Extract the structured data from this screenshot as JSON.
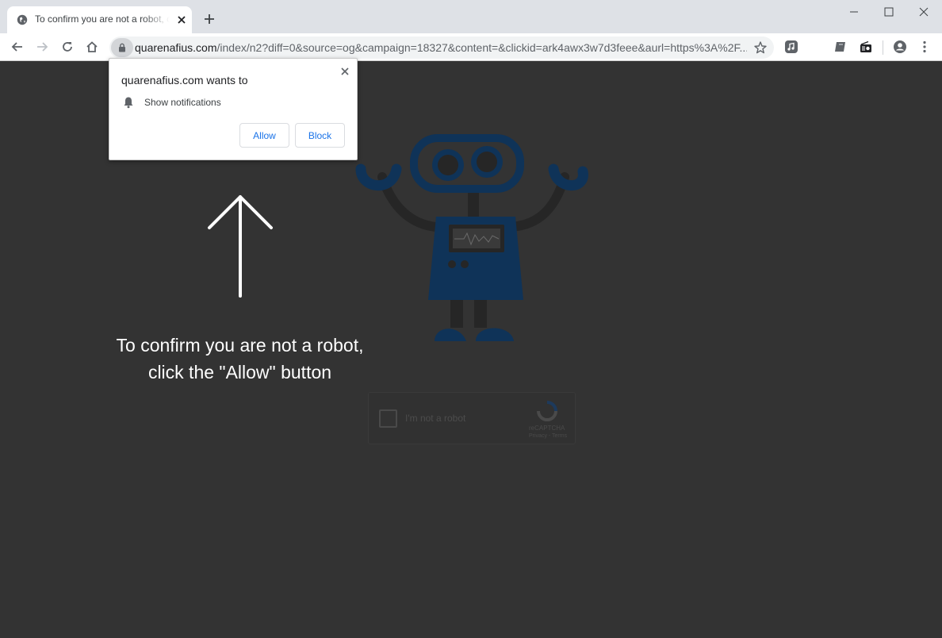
{
  "browser": {
    "tab": {
      "title": "To confirm you are not a robot, click the \"Allow\" button"
    },
    "address_bar": {
      "host": "quarenafius.com",
      "path": "/index/n2?diff=0&source=og&campaign=18327&content=&clickid=ark4awx3w7d3feee&aurl=https%3A%2F..."
    },
    "icons": [
      "globe-icon",
      "close-icon",
      "plus-icon",
      "minimize-icon",
      "maximize-icon",
      "back-icon",
      "forward-icon",
      "reload-icon",
      "home-icon",
      "lock-icon",
      "star-icon",
      "music-extension-icon",
      "extension-icon",
      "radio-extension-icon",
      "profile-icon",
      "menu-icon"
    ]
  },
  "permission_prompt": {
    "title": "quarenafius.com wants to",
    "permission": "Show notifications",
    "allow_label": "Allow",
    "block_label": "Block"
  },
  "page": {
    "instruction_line1": "To confirm you are not a robot,",
    "instruction_line2": "click the \"Allow\" button",
    "captcha": {
      "label": "I'm not a robot",
      "brand": "reCAPTCHA",
      "terms": "Privacy - Terms"
    }
  },
  "colors": {
    "page_background": "#333333",
    "robot_blue": "#0f3358",
    "robot_dark": "#262626",
    "link_blue": "#1a73e8"
  }
}
